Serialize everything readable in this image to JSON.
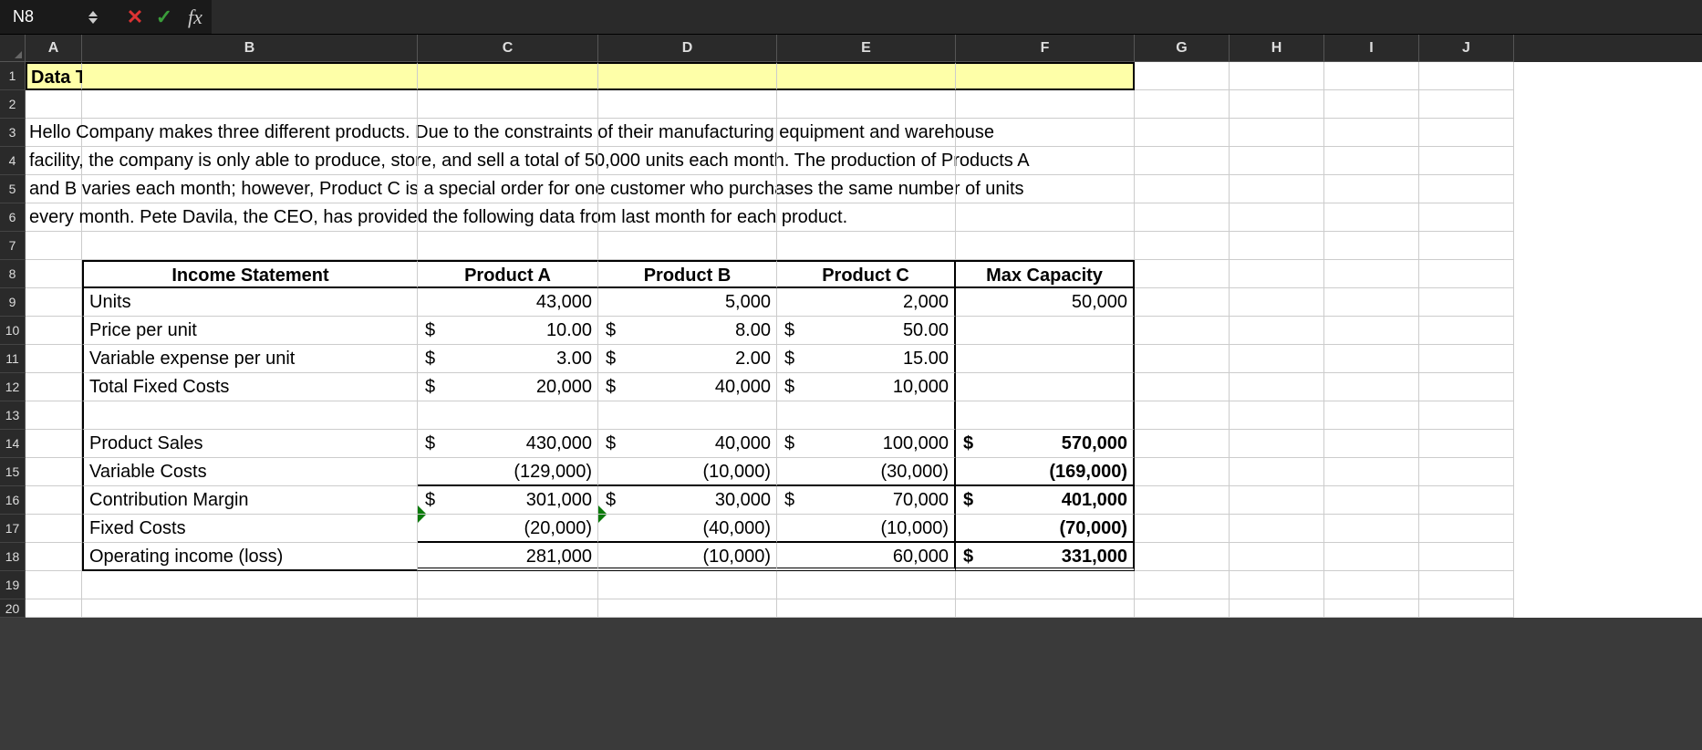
{
  "name_box": "N8",
  "formula_value": "",
  "columns": [
    "A",
    "B",
    "C",
    "D",
    "E",
    "F",
    "G",
    "H",
    "I",
    "J"
  ],
  "rows_visible": [
    "1",
    "2",
    "3",
    "4",
    "5",
    "6",
    "7",
    "8",
    "9",
    "10",
    "11",
    "12",
    "13",
    "14",
    "15",
    "16",
    "17",
    "18",
    "19",
    "20"
  ],
  "title": "Data Tables - Example",
  "paragraph": {
    "l1": "Hello Company makes three different products.  Due to the constraints of their manufacturing equipment and warehouse",
    "l2": "facility, the company is only able to produce, store, and sell a total of 50,000 units each month.  The production of Products A",
    "l3": "and B varies each month; however, Product C is a special order for one customer who purchases the same number of units",
    "l4": "every month.  Pete Davila, the CEO, has provided the following data from last month for each product."
  },
  "headers": {
    "income_statement": "Income Statement",
    "product_a": "Product A",
    "product_b": "Product B",
    "product_c": "Product C",
    "max_capacity": "Max Capacity"
  },
  "labels": {
    "units": "Units",
    "price_per_unit": "Price per unit",
    "var_exp_per_unit": "Variable expense per unit",
    "total_fixed_costs": "Total Fixed Costs",
    "product_sales": "Product Sales",
    "variable_costs": "Variable Costs",
    "contribution_margin": "Contribution Margin",
    "fixed_costs": "Fixed Costs",
    "operating_income": "Operating income (loss)"
  },
  "vals": {
    "units": {
      "a": "43,000",
      "b": "5,000",
      "c": "2,000",
      "max": "50,000"
    },
    "price": {
      "a": "10.00",
      "b": "8.00",
      "c": "50.00"
    },
    "varexp": {
      "a": "3.00",
      "b": "2.00",
      "c": "15.00"
    },
    "fixed": {
      "a": "20,000",
      "b": "40,000",
      "c": "10,000"
    },
    "sales": {
      "a": "430,000",
      "b": "40,000",
      "c": "100,000",
      "f": "570,000"
    },
    "varcost": {
      "a": "(129,000)",
      "b": "(10,000)",
      "c": "(30,000)",
      "f": "(169,000)"
    },
    "contrib": {
      "a": "301,000",
      "b": "30,000",
      "c": "70,000",
      "f": "401,000"
    },
    "fixedc": {
      "a": "(20,000)",
      "b": "(40,000)",
      "c": "(10,000)",
      "f": "(70,000)"
    },
    "opinc": {
      "a": "281,000",
      "b": "(10,000)",
      "c": "60,000",
      "f": "331,000"
    }
  },
  "sym": "$",
  "chart_data": {
    "type": "table",
    "title": "Income Statement",
    "columns": [
      "Product A",
      "Product B",
      "Product C",
      "Max Capacity"
    ],
    "rows": [
      {
        "label": "Units",
        "values": [
          43000,
          5000,
          2000,
          50000
        ]
      },
      {
        "label": "Price per unit",
        "values": [
          10.0,
          8.0,
          50.0,
          null
        ]
      },
      {
        "label": "Variable expense per unit",
        "values": [
          3.0,
          2.0,
          15.0,
          null
        ]
      },
      {
        "label": "Total Fixed Costs",
        "values": [
          20000,
          40000,
          10000,
          null
        ]
      },
      {
        "label": "Product Sales",
        "values": [
          430000,
          40000,
          100000,
          570000
        ]
      },
      {
        "label": "Variable Costs",
        "values": [
          -129000,
          -10000,
          -30000,
          -169000
        ]
      },
      {
        "label": "Contribution Margin",
        "values": [
          301000,
          30000,
          70000,
          401000
        ]
      },
      {
        "label": "Fixed Costs",
        "values": [
          -20000,
          -40000,
          -10000,
          -70000
        ]
      },
      {
        "label": "Operating income (loss)",
        "values": [
          281000,
          -10000,
          60000,
          331000
        ]
      }
    ]
  }
}
